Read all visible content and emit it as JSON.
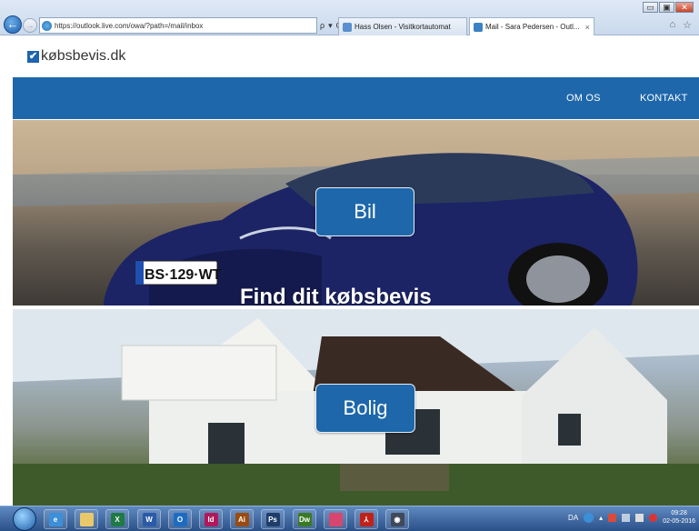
{
  "browser": {
    "url": "https://outlook.live.com/owa/?path=/mail/inbox",
    "search_glyph": "ρ",
    "dropdown_glyph": "▾",
    "refresh_glyph": "C",
    "tabs": [
      {
        "label": "Hass Olsen - Visitkortautomat",
        "icon_color": "#5b8fcf"
      },
      {
        "label": "Mail - Sara Pedersen - Outl...",
        "icon_color": "#3b82c4",
        "close": "×"
      }
    ],
    "window_buttons": {
      "minimize": "▭",
      "maximize": "▣",
      "close": "✕"
    },
    "back_glyph": "←",
    "forward_glyph": "→",
    "home_glyph": "⌂",
    "favorites_glyph": "☆"
  },
  "site": {
    "logo_check": "✔",
    "logo_text": "købsbevis.dk",
    "nav": [
      "OM OS",
      "KONTAKT"
    ],
    "car_button": "Bil",
    "house_button": "Bolig",
    "tagline": "Find dit købsbevis",
    "license_plate": "BS·129·WT",
    "brand_color": "#1e67ab"
  },
  "taskbar": {
    "apps": [
      {
        "name": "internet-explorer",
        "label": "e",
        "color": "#3c8fd8"
      },
      {
        "name": "file-explorer",
        "label": "",
        "color": "#e8c869"
      },
      {
        "name": "excel",
        "label": "X",
        "color": "#1f7a45"
      },
      {
        "name": "word",
        "label": "W",
        "color": "#2b5aa8"
      },
      {
        "name": "outlook",
        "label": "O",
        "color": "#1d6cc1"
      },
      {
        "name": "indesign",
        "label": "Id",
        "color": "#b0195b"
      },
      {
        "name": "illustrator",
        "label": "Ai",
        "color": "#9a4b10"
      },
      {
        "name": "photoshop",
        "label": "Ps",
        "color": "#1f3d69"
      },
      {
        "name": "dreamweaver",
        "label": "Dw",
        "color": "#3b7a25"
      },
      {
        "name": "paint-app",
        "label": "",
        "color": "#d6466e"
      },
      {
        "name": "acrobat",
        "label": "⅄",
        "color": "#c0221a"
      },
      {
        "name": "media-app",
        "label": "◉",
        "color": "#40495a"
      }
    ],
    "language": "DA",
    "time": "09:28",
    "date": "02-05-2016"
  }
}
